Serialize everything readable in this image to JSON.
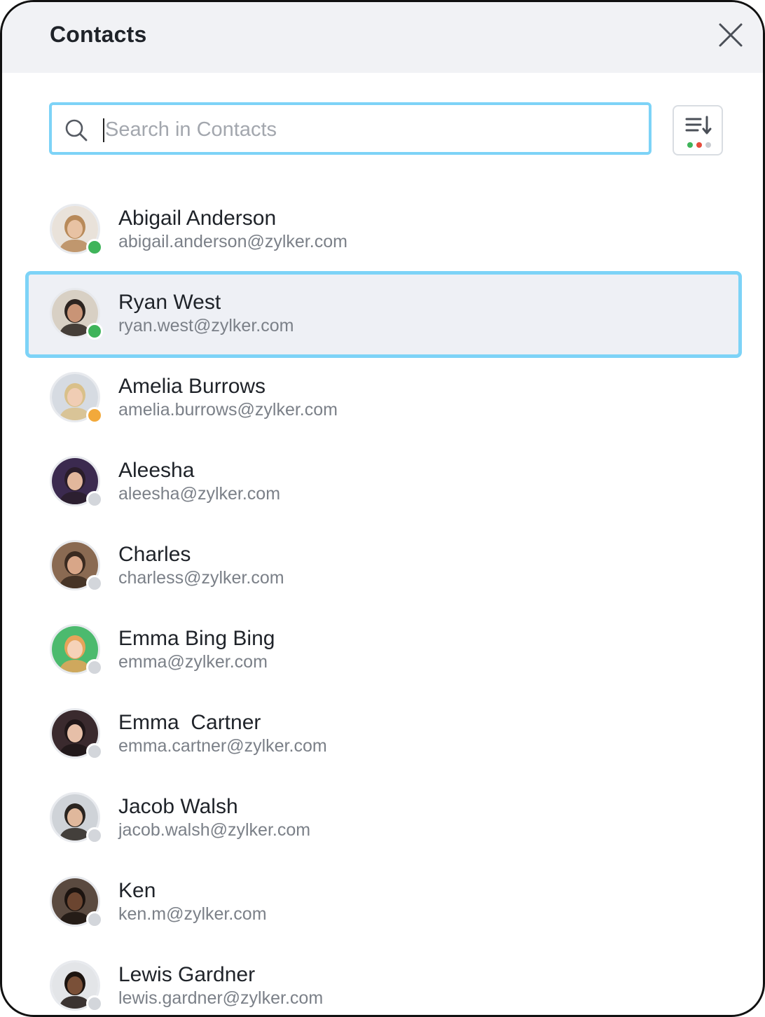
{
  "header": {
    "title": "Contacts"
  },
  "search": {
    "placeholder": "Search in Contacts",
    "value": ""
  },
  "sort": {
    "dot_colors": [
      "#3fb45a",
      "#e64c3c",
      "#c9ccd1"
    ]
  },
  "colors": {
    "accent": "#7dd3f7",
    "online": "#3fb45a",
    "away": "#f2a93b",
    "offline": "#d3d6db"
  },
  "contacts": [
    {
      "name": "Abigail Anderson",
      "email": "abigail.anderson@zylker.com",
      "status": "online",
      "selected": false
    },
    {
      "name": "Ryan West",
      "email": "ryan.west@zylker.com",
      "status": "online",
      "selected": true
    },
    {
      "name": "Amelia Burrows",
      "email": "amelia.burrows@zylker.com",
      "status": "away",
      "selected": false
    },
    {
      "name": "Aleesha",
      "email": "aleesha@zylker.com",
      "status": "offline",
      "selected": false
    },
    {
      "name": "Charles",
      "email": "charless@zylker.com",
      "status": "offline",
      "selected": false
    },
    {
      "name": "Emma Bing Bing",
      "email": "emma@zylker.com",
      "status": "offline",
      "selected": false
    },
    {
      "name": "Emma  Cartner",
      "email": "emma.cartner@zylker.com",
      "status": "offline",
      "selected": false
    },
    {
      "name": "Jacob Walsh",
      "email": "jacob.walsh@zylker.com",
      "status": "offline",
      "selected": false
    },
    {
      "name": "Ken",
      "email": "ken.m@zylker.com",
      "status": "offline",
      "selected": false
    },
    {
      "name": "Lewis Gardner",
      "email": "lewis.gardner@zylker.com",
      "status": "offline",
      "selected": false
    }
  ]
}
